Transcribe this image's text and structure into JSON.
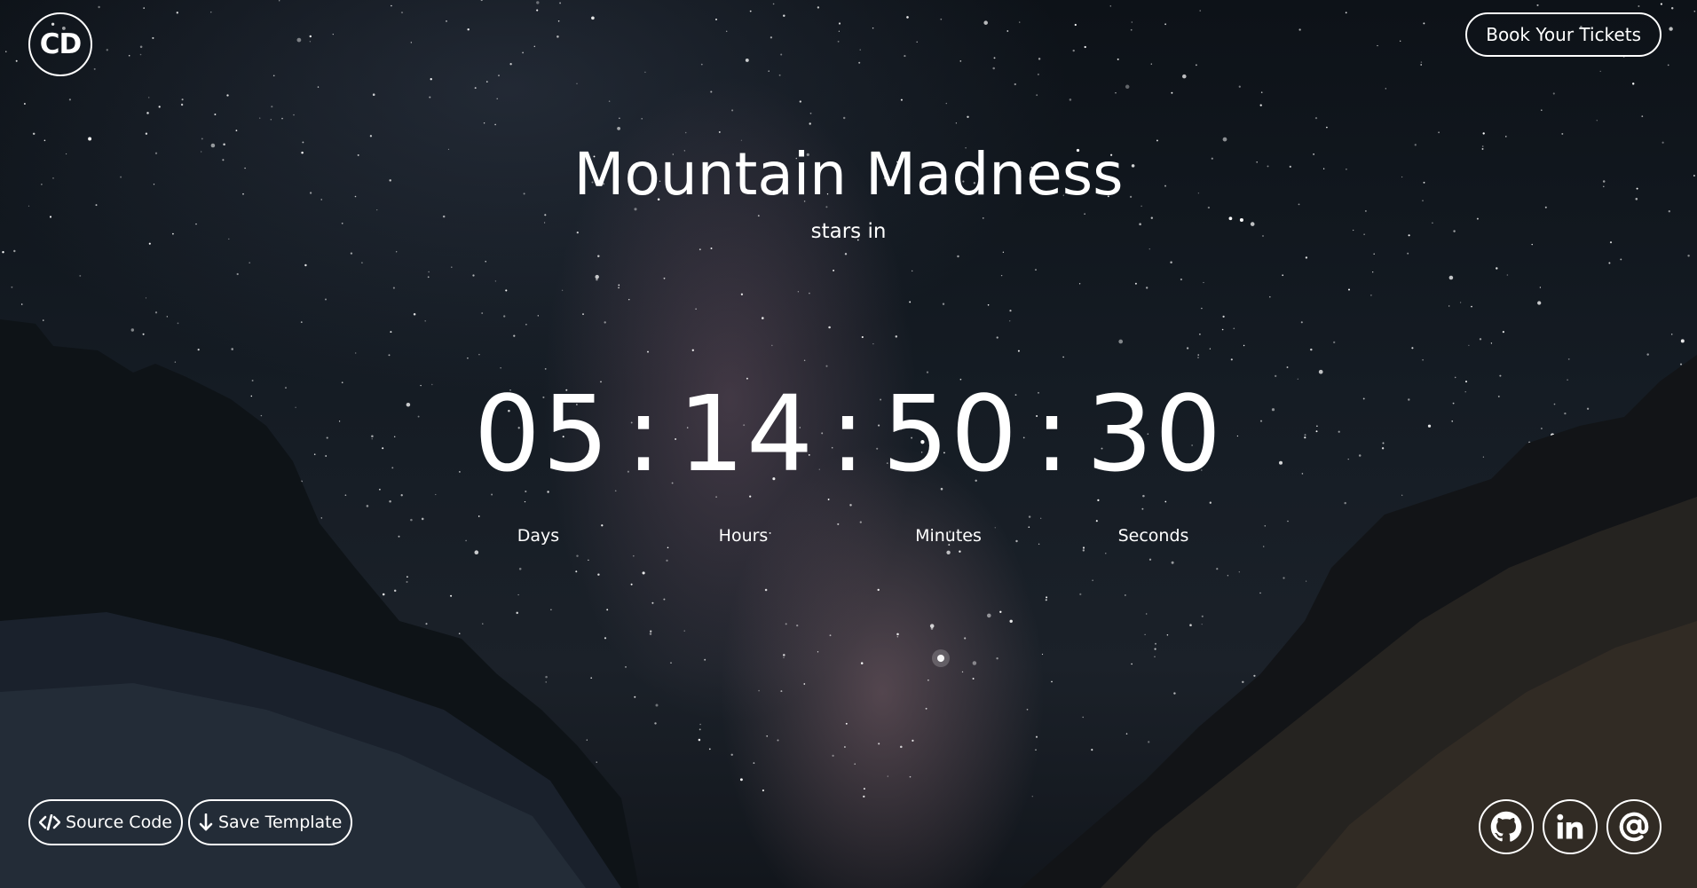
{
  "brand": {
    "logo_text": "CD"
  },
  "header": {
    "cta_label": "Book Your Tickets"
  },
  "hero": {
    "title": "Mountain Madness",
    "subtitle": "stars in"
  },
  "countdown": {
    "days": "05",
    "hours": "14",
    "minutes": "50",
    "seconds": "30",
    "separator": ":",
    "labels": {
      "days": "Days",
      "hours": "Hours",
      "minutes": "Minutes",
      "seconds": "Seconds"
    }
  },
  "footer": {
    "source_code_label": "Source Code",
    "save_template_label": "Save Template",
    "social": [
      {
        "icon": "github-icon"
      },
      {
        "icon": "linkedin-icon"
      },
      {
        "icon": "at-sign-icon"
      }
    ]
  }
}
